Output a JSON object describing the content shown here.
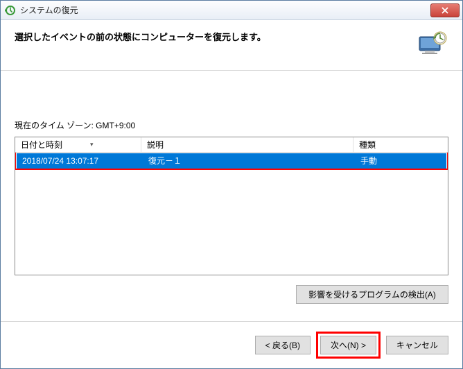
{
  "window": {
    "title": "システムの復元"
  },
  "header": {
    "heading": "選択したイベントの前の状態にコンピューターを復元します。"
  },
  "timezone_label": "現在のタイム ゾーン: GMT+9:00",
  "table": {
    "columns": {
      "date": "日付と時刻",
      "desc": "説明",
      "type": "種類"
    },
    "rows": [
      {
        "date": "2018/07/24 13:07:17",
        "desc": "復元－１",
        "type": "手動"
      }
    ]
  },
  "buttons": {
    "scan_affected": "影響を受けるプログラムの検出(A)",
    "back": "< 戻る(B)",
    "next": "次へ(N) >",
    "cancel": "キャンセル"
  }
}
